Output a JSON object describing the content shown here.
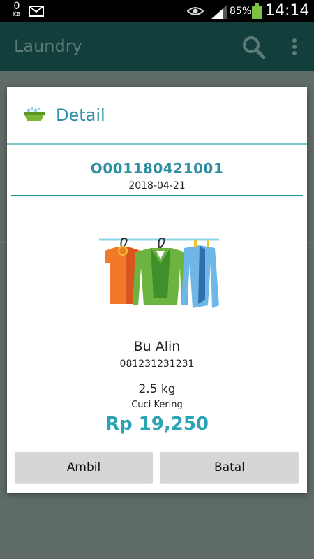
{
  "status_bar": {
    "data_counter": "0",
    "data_unit": "KB",
    "battery_percent": "85%",
    "time": "14:14"
  },
  "app_bar": {
    "title": "Laundry"
  },
  "dialog": {
    "title": "Detail",
    "order_id": "O001180421001",
    "date": "2018-04-21",
    "customer_name": "Bu Alin",
    "customer_phone": "081231231231",
    "weight": "2.5 kg",
    "service": "Cuci Kering",
    "price": "Rp 19,250",
    "buttons": {
      "ambil": "Ambil",
      "batal": "Batal"
    }
  },
  "colors": {
    "accent": "#2a8fa0",
    "price": "#2aa3b5",
    "app_bar_dimmed": "#123f3b"
  }
}
